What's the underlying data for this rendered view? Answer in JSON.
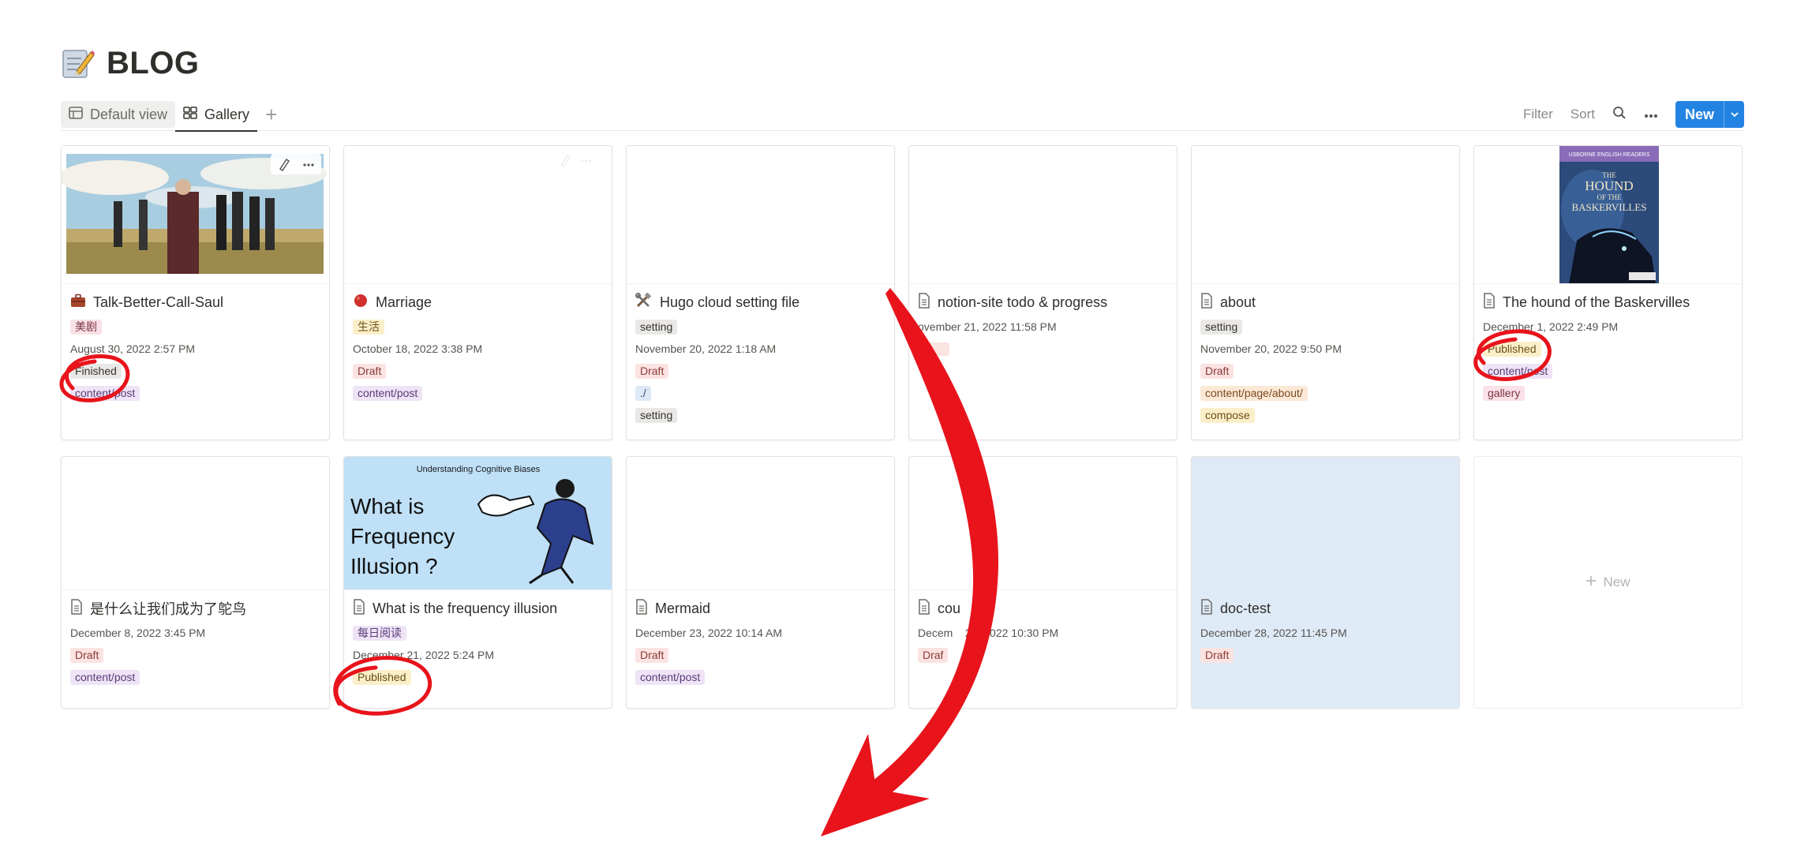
{
  "page": {
    "title": "BLOG",
    "icon": "memo-pencil-icon"
  },
  "views": {
    "tabs": [
      {
        "label": "Default view",
        "icon": "table-icon"
      },
      {
        "label": "Gallery",
        "icon": "gallery-grid-icon"
      }
    ],
    "add": "+"
  },
  "toolbar": {
    "filter": "Filter",
    "sort": "Sort",
    "new_label": "New"
  },
  "cards": [
    {
      "title": "Talk-Better-Call-Saul",
      "icon": "briefcase-icon",
      "tags": [
        "美剧"
      ],
      "date": "August 30, 2022 2:57 PM",
      "status": "Finished",
      "path": "content/post"
    },
    {
      "title": "Marriage",
      "icon": "red-circle-icon",
      "tags": [
        "生活"
      ],
      "date": "October 18, 2022 3:38 PM",
      "status": "Draft",
      "path": "content/post"
    },
    {
      "title": "Hugo cloud setting file",
      "icon": "tools-icon",
      "tags": [
        "setting"
      ],
      "date": "November 20, 2022 1:18 AM",
      "status": "Draft",
      "path": "./",
      "extra": "setting"
    },
    {
      "title": "notion-site todo & progress",
      "icon": "document-icon",
      "date": "ovember 21, 2022 11:58 PM"
    },
    {
      "title": "about",
      "icon": "document-icon",
      "tags": [
        "setting"
      ],
      "date": "November 20, 2022 9:50 PM",
      "status": "Draft",
      "path": "content/page/about/",
      "extra": "compose"
    },
    {
      "title": "The hound of the Baskervilles",
      "icon": "document-icon",
      "date": "December 1, 2022 2:49 PM",
      "status": "Published",
      "path": "content/post",
      "extra": "gallery"
    },
    {
      "title": "是什么让我们成为了鸵鸟",
      "icon": "document-icon",
      "date": "December 8, 2022 3:45 PM",
      "status": "Draft",
      "path": "content/post"
    },
    {
      "title": "What is the frequency illusion",
      "icon": "document-icon",
      "tags": [
        "每日阅读"
      ],
      "date": "December 21, 2022 5:24 PM",
      "status": "Published"
    },
    {
      "title": "Mermaid",
      "icon": "document-icon",
      "date": "December 23, 2022 10:14 AM",
      "status": "Draft",
      "path": "content/post"
    },
    {
      "title": "cou",
      "icon": "document-icon",
      "date": "Decem    28, 2022 10:30 PM",
      "status": "Draf"
    },
    {
      "title": "doc-test",
      "icon": "document-icon",
      "date": "December 28, 2022 11:45 PM",
      "status": "Draft"
    }
  ],
  "new_card": {
    "label": "New"
  },
  "covers": {
    "frequency": {
      "heading": "Understanding Cognitive Biases",
      "line1": "What is",
      "line2": "Frequency",
      "line3": "Illusion ?"
    },
    "book": {
      "series": "USBORNE ENGLISH READERS",
      "line1": "THE",
      "line2": "HOUND",
      "line3": "OF THE",
      "line4": "BASKERVILLES"
    }
  },
  "colors": {
    "accent": "#2383e2",
    "annotation": "#e8131b",
    "card_blue": "#dfeaf7"
  }
}
